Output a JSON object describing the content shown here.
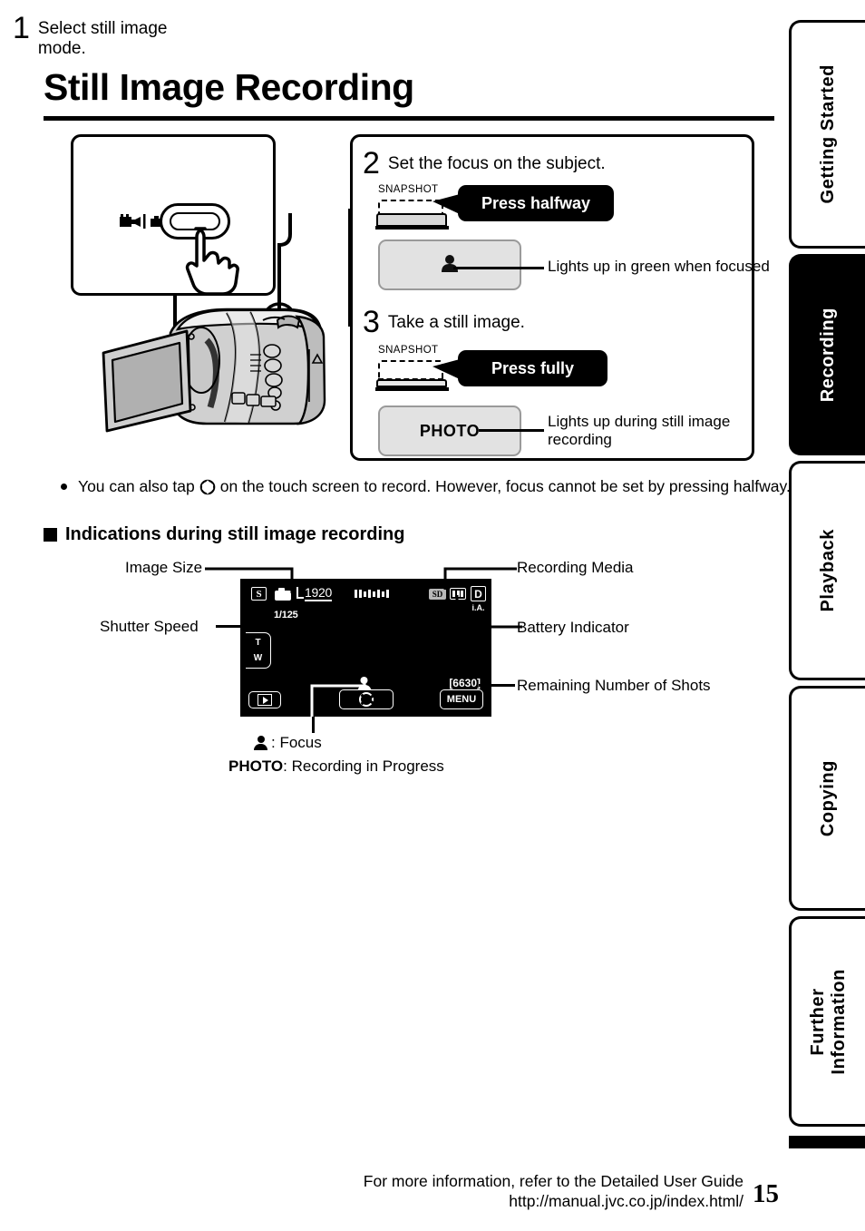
{
  "page": {
    "title": "Still Image Recording",
    "number": "15"
  },
  "steps": [
    {
      "num": "1",
      "text": "Select still image mode.",
      "mode_label": " | "
    },
    {
      "num": "2",
      "text": "Set the focus on the subject.",
      "snapshot_label": "SNAPSHOT",
      "balloon": "Press halfway",
      "indicator_caption": "Lights up in green when focused"
    },
    {
      "num": "3",
      "text": "Take a still image.",
      "snapshot_label": "SNAPSHOT",
      "balloon": "Press fully",
      "indicator_label": "PHOTO",
      "indicator_caption": "Lights up during still image recording"
    }
  ],
  "note": {
    "bullet": "You can also tap   on the touch screen to record. However, focus cannot be set by pressing halfway.",
    "bullet_part1": "You can also tap",
    "bullet_part2": "on the touch screen to record. However, focus cannot be set by pressing halfway."
  },
  "section": {
    "heading": "Indications during still image recording"
  },
  "lcd": {
    "icons": {
      "s_mode": "S",
      "image_size": "1920",
      "shutter_speed": "1/125",
      "recording_media": "SD",
      "mode_d": "D",
      "ia_label": "i.A.",
      "zoom_t": "T",
      "zoom_w": "W",
      "remaining_shots": "[6630]",
      "menu_button": "MENU"
    }
  },
  "annotations": {
    "image_size": "Image Size",
    "shutter_speed": "Shutter Speed",
    "recording_media": "Recording Media",
    "battery_indicator": "Battery Indicator",
    "remaining_shots": "Remaining Number of Shots"
  },
  "legend": [
    {
      "symbol": "person-icon",
      "text": ": Focus"
    },
    {
      "symbol": "PHOTO",
      "text": ": Recording in Progress"
    }
  ],
  "legend_photo_word": "PHOTO",
  "tabs": [
    {
      "label": "Getting Started",
      "active": false
    },
    {
      "label": "Recording",
      "active": true
    },
    {
      "label": "Playback",
      "active": false
    },
    {
      "label": "Copying",
      "active": false
    },
    {
      "label": "Further\nInformation",
      "active": false
    }
  ],
  "footer": {
    "line1": "For more information, refer to the Detailed User Guide",
    "line2": "http://manual.jvc.co.jp/index.html/"
  },
  "colors": {
    "ink": "#000000",
    "panel_grey": "#e2e2e2",
    "panel_border": "#9a9a9a",
    "lcd_bg": "#000000"
  }
}
